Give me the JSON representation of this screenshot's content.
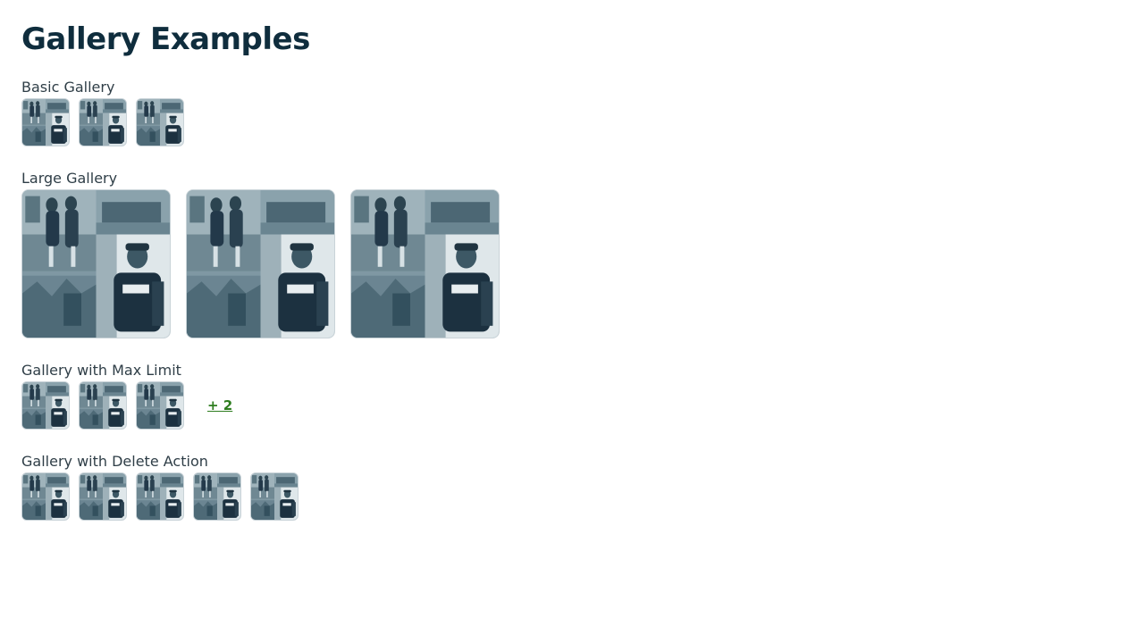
{
  "page": {
    "title": "Gallery Examples"
  },
  "sections": {
    "basic": {
      "label": "Basic Gallery",
      "image_count": 3
    },
    "large": {
      "label": "Large Gallery",
      "image_count": 3
    },
    "max_limit": {
      "label": "Gallery with Max Limit",
      "image_count": 3,
      "more_label": "+ 2"
    },
    "delete": {
      "label": "Gallery with Delete Action",
      "image_count": 5
    }
  },
  "colors": {
    "title": "#0f2d3d",
    "label": "#2f3e47",
    "link": "#2e7d1f",
    "photo_tint": "#4a6b7a"
  }
}
